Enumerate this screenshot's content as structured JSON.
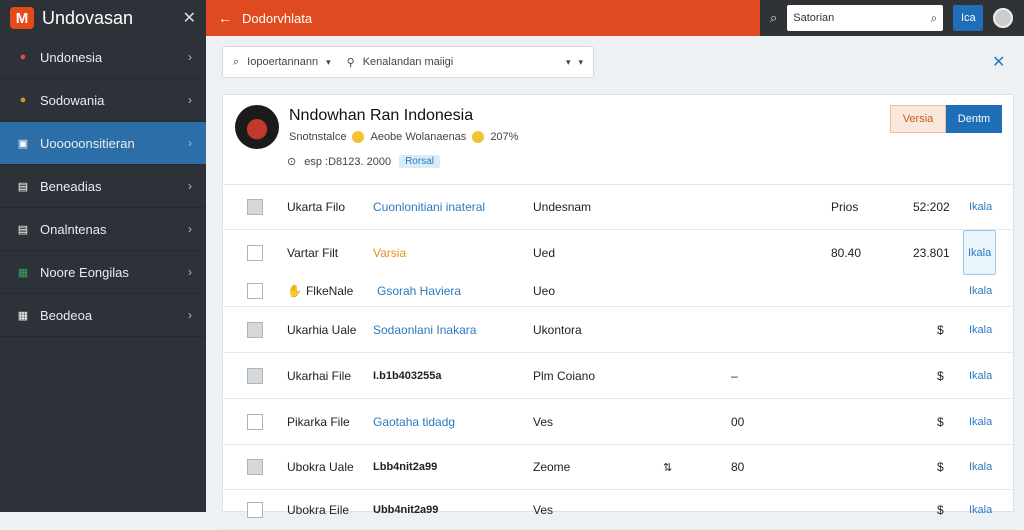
{
  "app": {
    "logo_text": "M",
    "name": "Undovasan",
    "close_icon": "close-icon"
  },
  "sidebar": {
    "items": [
      {
        "label": "Undonesia",
        "icon": "flag-icon",
        "icon_color": "#e0503a"
      },
      {
        "label": "Sodowania",
        "icon": "flag-icon",
        "icon_color": "#e0902a"
      },
      {
        "label": "Uooooonsitieran",
        "icon": "square-icon",
        "icon_color": "#ffffff"
      },
      {
        "label": "Beneadias",
        "icon": "document-icon",
        "icon_color": "#ffffff"
      },
      {
        "label": "Onalntenas",
        "icon": "document-icon",
        "icon_color": "#ffffff"
      },
      {
        "label": "Noore Eongilas",
        "icon": "grid-icon",
        "icon_color": "#3da35d"
      },
      {
        "label": "Beodeoa",
        "icon": "grid-icon",
        "icon_color": "#ffffff"
      }
    ]
  },
  "topbar": {
    "back_icon": "arrow-left-icon",
    "title": "Dodorvhlata",
    "search_placeholder": "Satorian",
    "button_label": "Ica"
  },
  "filters": {
    "first": "Iopoertannann",
    "second": "Kenalandan maiigi"
  },
  "record": {
    "title": "Nndowhan Ran Indonesia",
    "subtitle_a": "Snotnstalce",
    "subtitle_b": "Aeobe Wolanaenas",
    "subtitle_c": "207%",
    "meta_text": "esp :D8123. 2000",
    "badge": "Rorsal",
    "versia_label": "Versia",
    "dentm_label": "Dentm"
  },
  "rows": [
    {
      "checked": true,
      "name": "Ukarta Filo",
      "desc": "Cuonlonitiani inateral",
      "desc_style": "link",
      "col3": "Undesnam",
      "col4": "",
      "col5": "Prios",
      "col6": "52:202",
      "action": "Ikala"
    },
    {
      "checked": false,
      "name": "Vartar Filt",
      "desc": "Varsia",
      "desc_style": "orange",
      "col3": "Ued",
      "col4": "",
      "col5": "80.40",
      "col6": "23.801",
      "action": "Ikala",
      "boxed": true
    },
    {
      "checked": false,
      "name": "FlkeNale",
      "desc": "Gsorah Haviera",
      "desc_style": "link",
      "col3": "Ueo",
      "col4": "",
      "col5": "",
      "col6": "",
      "action": "Ikala",
      "hand": true
    },
    {
      "checked": true,
      "name": "Ukarhia Uale",
      "desc": "Sodaonlani Inakara",
      "desc_style": "link",
      "col3": "Ukontora",
      "col4": "",
      "col5": "",
      "col6": "$",
      "action": "Ikala"
    },
    {
      "checked": true,
      "name": "Ukarhai File",
      "desc": "I.b1b403255a",
      "desc_style": "bold",
      "col3": "Plm Coiano",
      "col4": "–",
      "col5": "",
      "col6": "$",
      "action": "Ikala"
    },
    {
      "checked": false,
      "name": "Pikarka File",
      "desc": "Gaotaha tidadg",
      "desc_style": "link",
      "col3": "Ves",
      "col4": "00",
      "col5": "",
      "col6": "$",
      "action": "Ikala"
    },
    {
      "checked": true,
      "name": "Ubokra Uale",
      "desc": "Lbb4nit2a99",
      "desc_style": "bold",
      "col3": "Zeome",
      "col4": "80",
      "col5": "",
      "col6": "$",
      "action": "Ikala",
      "sort": true
    },
    {
      "checked": false,
      "name": "Ubokra Eile",
      "desc": "Ubb4nit2a99",
      "desc_style": "bold",
      "col3": "Ves",
      "col4": "",
      "col5": "",
      "col6": "$",
      "action": "Ikala"
    }
  ]
}
